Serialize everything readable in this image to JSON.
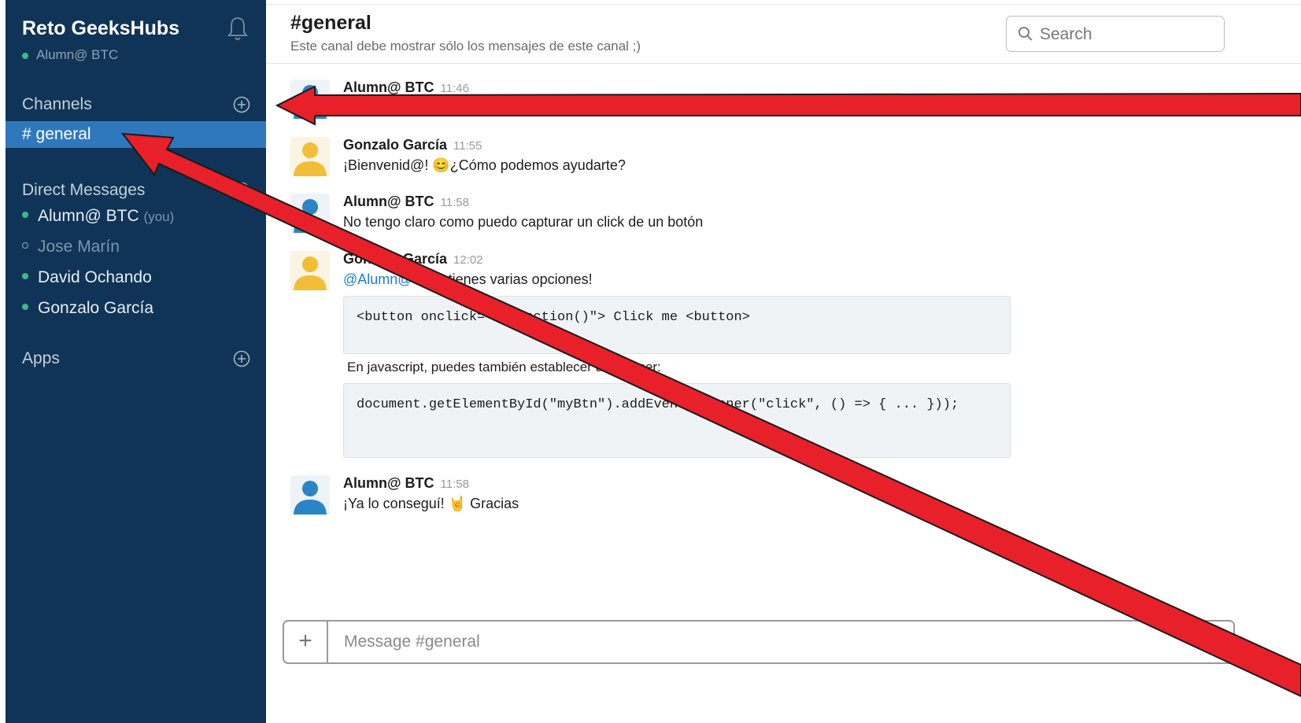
{
  "team": {
    "name": "Reto GeeksHubs",
    "user": "Alumn@ BTC"
  },
  "sidebar": {
    "channels_label": "Channels",
    "channels": [
      {
        "label": "# general"
      }
    ],
    "dm_label": "Direct Messages",
    "dms": [
      {
        "name": "Alumn@ BTC",
        "suffix": "(you)",
        "status": "online"
      },
      {
        "name": "Jose Marín",
        "status": "offline"
      },
      {
        "name": "David Ochando",
        "status": "online"
      },
      {
        "name": "Gonzalo García",
        "status": "online"
      }
    ],
    "apps_label": "Apps"
  },
  "header": {
    "channel": "#general",
    "description": "Este canal debe mostrar sólo los mensajes de este canal ;)",
    "search_placeholder": "Search"
  },
  "messages": [
    {
      "author": "Alumn@ BTC",
      "time": "11:46",
      "text": "..."
    },
    {
      "author": "Gonzalo García",
      "time": "11:55",
      "text": "¡Bienvenid@! 😊¿Cómo podemos ayudarte?"
    },
    {
      "author": "Alumn@ BTC",
      "time": "11:58",
      "text": "No tengo claro como puedo capturar un click de un botón"
    },
    {
      "author": "Gonzalo García",
      "time": "12:02",
      "mention": "@Alumn@ BTC",
      "text": " tienes varias opciones!",
      "code1": "<button onclick=\"myFunction()\"> Click me <button>",
      "text2": "En javascript, puedes también establecer un listener:",
      "code2": "document.getElementById(\"myBtn\").addEventListener(\"click\", () => { ... }));"
    },
    {
      "author": "Alumn@ BTC",
      "time": "11:58",
      "text": "¡Ya lo conseguí! 🤘 Gracias"
    }
  ],
  "composer": {
    "placeholder": "Message #general"
  },
  "colors": {
    "sidebar": "#0f3457",
    "active_channel": "#2f78bd",
    "online": "#3dba86",
    "annotation_arrow": "#e8202a"
  }
}
